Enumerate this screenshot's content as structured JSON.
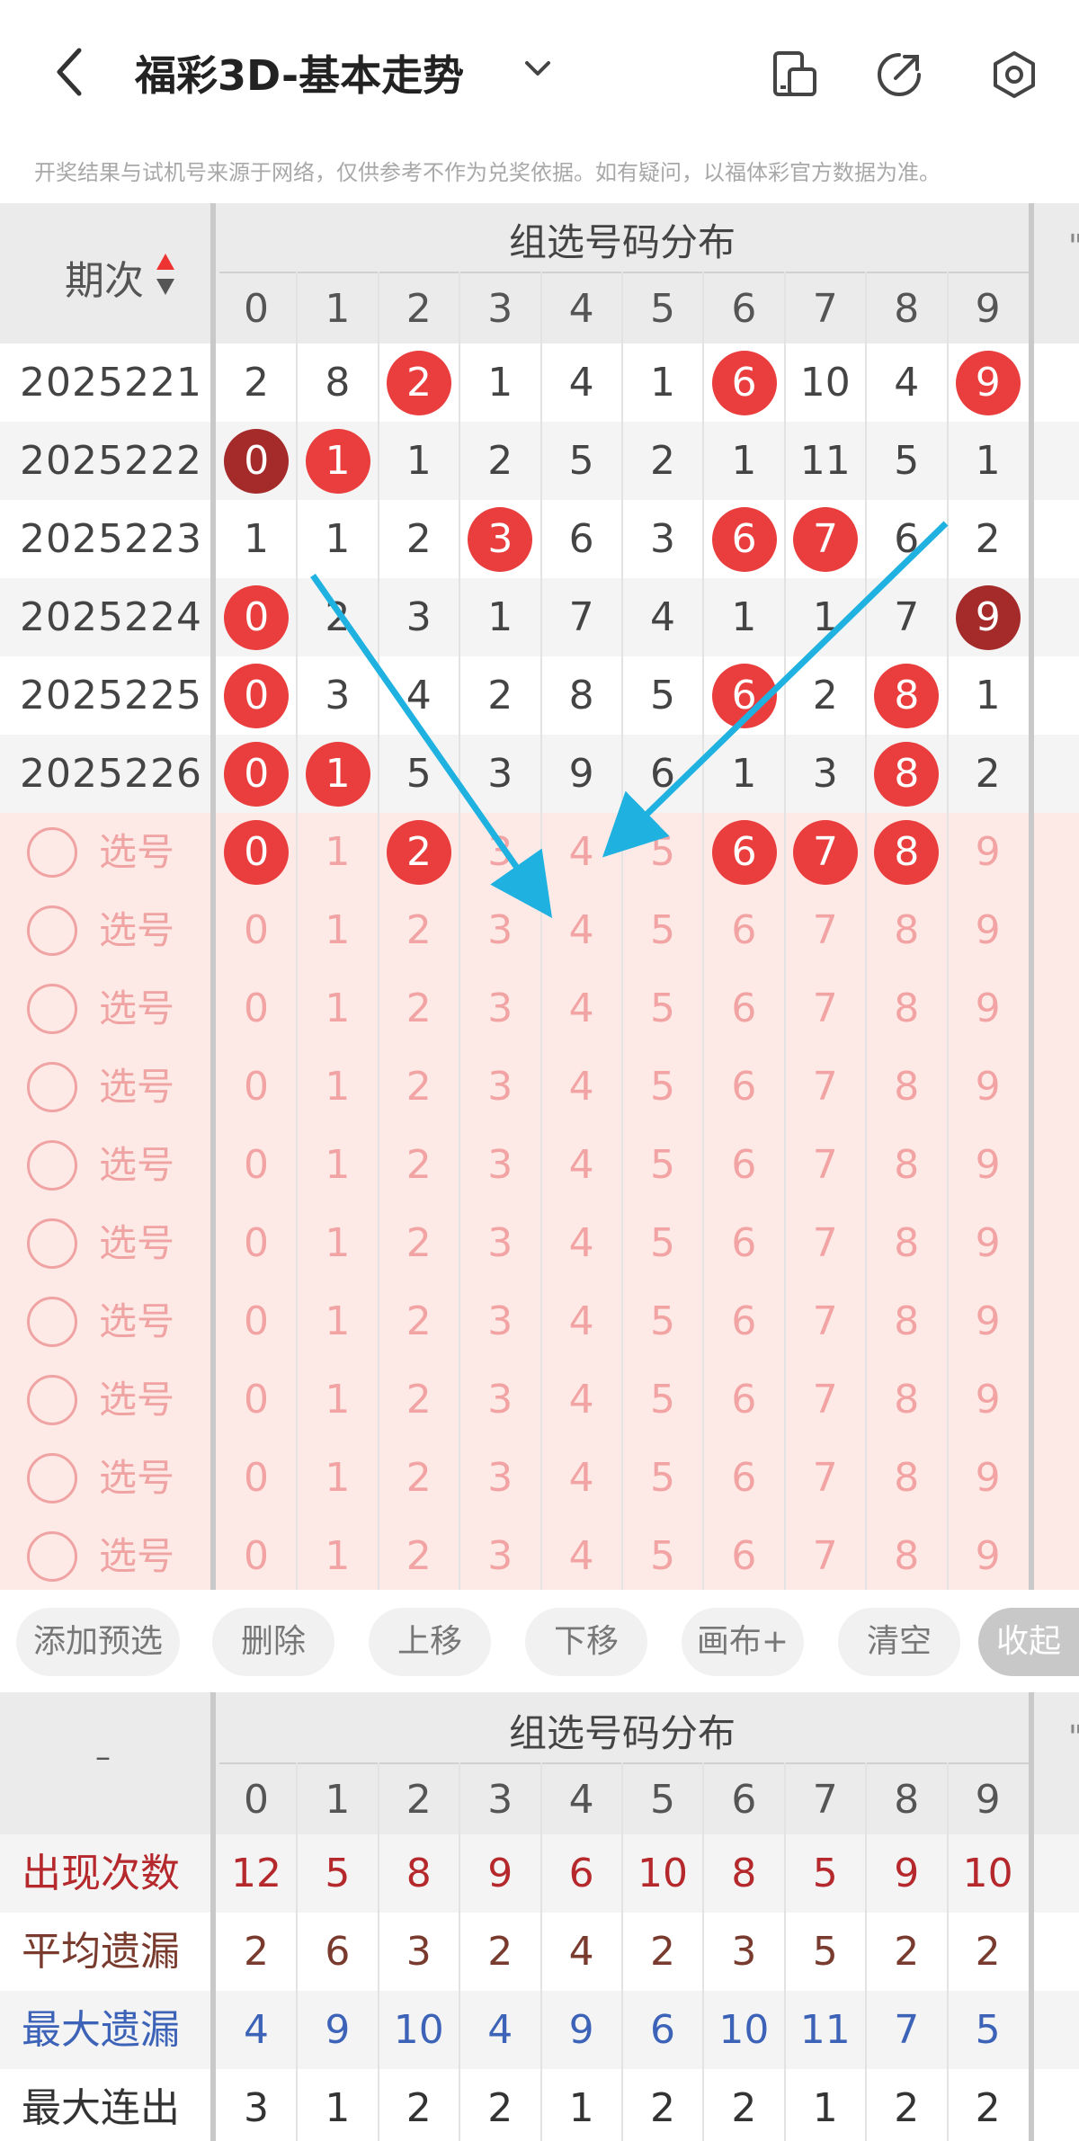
{
  "header": {
    "title": "福彩3D-基本走势",
    "disclaimer": "开奖结果与试机号来源于网络，仅供参考不作为兑奖依据。如有疑问，以福体彩官方数据为准。"
  },
  "top_table": {
    "group_title": "组选号码分布",
    "period_label": "期次",
    "digits": [
      "0",
      "1",
      "2",
      "3",
      "4",
      "5",
      "6",
      "7",
      "8",
      "9"
    ],
    "rows": [
      {
        "issue": "2025221",
        "cells": [
          "2",
          "8",
          "2",
          "1",
          "4",
          "1",
          "6",
          "10",
          "4",
          "9"
        ],
        "balls": {
          "2": "red",
          "6": "red",
          "9": "red"
        }
      },
      {
        "issue": "2025222",
        "cells": [
          "0",
          "1",
          "1",
          "2",
          "5",
          "2",
          "1",
          "11",
          "5",
          "1"
        ],
        "balls": {
          "0": "dark",
          "1": "red"
        }
      },
      {
        "issue": "2025223",
        "cells": [
          "1",
          "1",
          "2",
          "3",
          "6",
          "3",
          "6",
          "7",
          "6",
          "2"
        ],
        "balls": {
          "3": "red",
          "6": "red",
          "7": "red"
        }
      },
      {
        "issue": "2025224",
        "cells": [
          "0",
          "2",
          "3",
          "1",
          "7",
          "4",
          "1",
          "1",
          "7",
          "9"
        ],
        "balls": {
          "0": "red",
          "9": "dark"
        }
      },
      {
        "issue": "2025225",
        "cells": [
          "0",
          "3",
          "4",
          "2",
          "8",
          "5",
          "6",
          "2",
          "8",
          "1"
        ],
        "balls": {
          "0": "red",
          "6": "red",
          "8": "red"
        }
      },
      {
        "issue": "2025226",
        "cells": [
          "0",
          "1",
          "5",
          "3",
          "9",
          "6",
          "1",
          "3",
          "8",
          "2"
        ],
        "balls": {
          "0": "red",
          "1": "red",
          "8": "red"
        }
      }
    ],
    "pick_label": "选号",
    "pick_rows": [
      {
        "balls": [
          "0",
          "2",
          "6",
          "7",
          "8"
        ]
      },
      {
        "balls": []
      },
      {
        "balls": []
      },
      {
        "balls": []
      },
      {
        "balls": []
      },
      {
        "balls": []
      },
      {
        "balls": []
      },
      {
        "balls": []
      },
      {
        "balls": []
      },
      {
        "balls": []
      }
    ]
  },
  "toolbar": {
    "buttons": [
      "添加预选",
      "删除",
      "上移",
      "下移",
      "画布+",
      "清空",
      "收起"
    ]
  },
  "bottom_table": {
    "group_title": "组选号码分布",
    "corner_label": "–",
    "digits": [
      "0",
      "1",
      "2",
      "3",
      "4",
      "5",
      "6",
      "7",
      "8",
      "9"
    ],
    "stats": [
      {
        "label": "出现次数",
        "color": "#b5282c",
        "values": [
          "12",
          "5",
          "8",
          "9",
          "6",
          "10",
          "8",
          "5",
          "9",
          "10"
        ]
      },
      {
        "label": "平均遗漏",
        "color": "#7a3b2f",
        "values": [
          "2",
          "6",
          "3",
          "2",
          "4",
          "2",
          "3",
          "5",
          "2",
          "2"
        ]
      },
      {
        "label": "最大遗漏",
        "color": "#3c63b8",
        "values": [
          "4",
          "9",
          "10",
          "4",
          "9",
          "6",
          "10",
          "11",
          "7",
          "5"
        ]
      },
      {
        "label": "最大连出",
        "color": "#333333",
        "values": [
          "3",
          "1",
          "2",
          "2",
          "1",
          "2",
          "2",
          "1",
          "2",
          "2"
        ]
      }
    ]
  },
  "colors": {
    "ball_red": "#ea3d3d",
    "ball_dark": "#a52a2a",
    "arrow": "#1fb1e0",
    "pick_bg": "#fdeae6"
  },
  "icons": [
    "back-icon",
    "chevron-down-icon",
    "phone-layout-icon",
    "share-icon",
    "settings-icon",
    "sort-icon"
  ]
}
